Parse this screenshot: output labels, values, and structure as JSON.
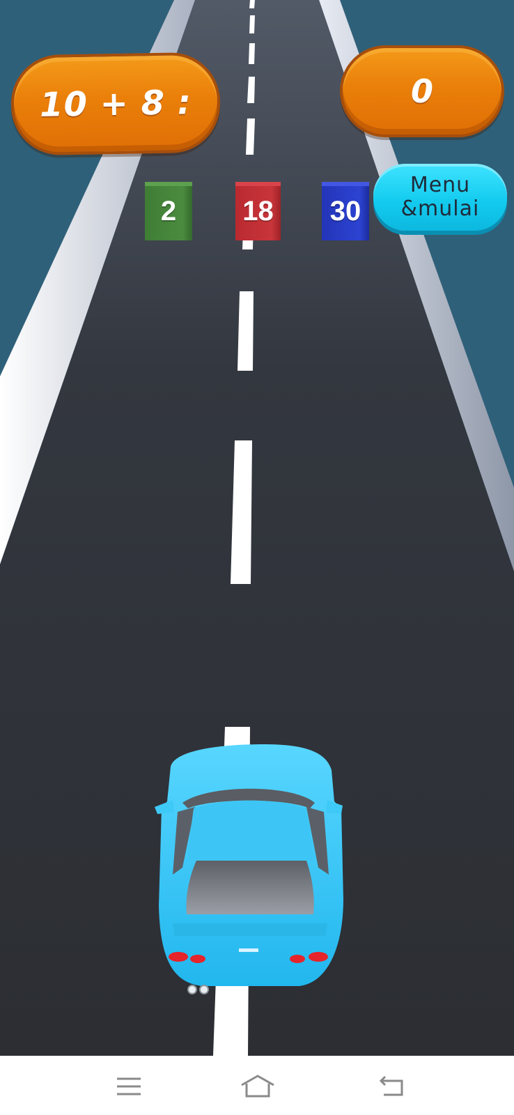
{
  "hud": {
    "question": "10 + 8 :",
    "score": "0"
  },
  "menu_button": {
    "line1": "Menu",
    "line2": "&mulai",
    "color": "#14ccef"
  },
  "answers": [
    {
      "value": "2",
      "color": "#4b8b3f"
    },
    {
      "value": "18",
      "color": "#c8353a"
    },
    {
      "value": "30",
      "color": "#2c43d2"
    }
  ],
  "player_car": {
    "color": "#33c7f5"
  },
  "system_nav": {
    "icons": [
      "menu-icon",
      "home-icon",
      "back-icon"
    ]
  }
}
